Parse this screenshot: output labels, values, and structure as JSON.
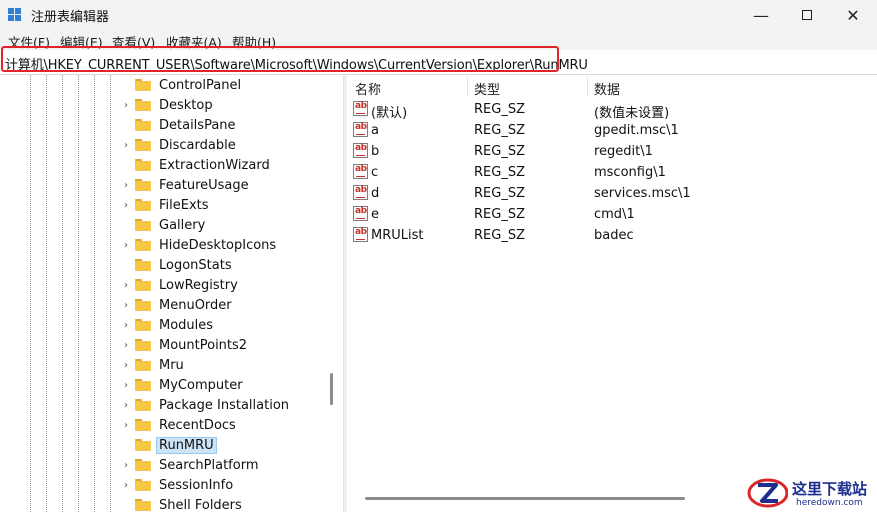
{
  "window": {
    "title": "注册表编辑器",
    "minimize": "—",
    "close": "✕"
  },
  "menu": [
    "文件(F)",
    "编辑(E)",
    "查看(V)",
    "收藏夹(A)",
    "帮助(H)"
  ],
  "address": "计算机\\HKEY_CURRENT_USER\\Software\\Microsoft\\Windows\\CurrentVersion\\Explorer\\RunMRU",
  "tree": {
    "items": [
      {
        "label": "ControlPanel",
        "expander": ""
      },
      {
        "label": "Desktop",
        "expander": "›"
      },
      {
        "label": "DetailsPane",
        "expander": ""
      },
      {
        "label": "Discardable",
        "expander": "›"
      },
      {
        "label": "ExtractionWizard",
        "expander": ""
      },
      {
        "label": "FeatureUsage",
        "expander": "›"
      },
      {
        "label": "FileExts",
        "expander": "›"
      },
      {
        "label": "Gallery",
        "expander": ""
      },
      {
        "label": "HideDesktopIcons",
        "expander": "›"
      },
      {
        "label": "LogonStats",
        "expander": ""
      },
      {
        "label": "LowRegistry",
        "expander": "›"
      },
      {
        "label": "MenuOrder",
        "expander": "›"
      },
      {
        "label": "Modules",
        "expander": "›"
      },
      {
        "label": "MountPoints2",
        "expander": "›"
      },
      {
        "label": "Mru",
        "expander": "›"
      },
      {
        "label": "MyComputer",
        "expander": "›"
      },
      {
        "label": "Package Installation",
        "expander": "›"
      },
      {
        "label": "RecentDocs",
        "expander": "›"
      },
      {
        "label": "RunMRU",
        "expander": "",
        "selected": true
      },
      {
        "label": "SearchPlatform",
        "expander": "›"
      },
      {
        "label": "SessionInfo",
        "expander": "›"
      },
      {
        "label": "Shell Folders",
        "expander": ""
      }
    ]
  },
  "values": {
    "columns": [
      "名称",
      "类型",
      "数据"
    ],
    "rows": [
      {
        "name": "(默认)",
        "type": "REG_SZ",
        "data": "(数值未设置)"
      },
      {
        "name": "a",
        "type": "REG_SZ",
        "data": "gpedit.msc\\1"
      },
      {
        "name": "b",
        "type": "REG_SZ",
        "data": "regedit\\1"
      },
      {
        "name": "c",
        "type": "REG_SZ",
        "data": "msconfig\\1"
      },
      {
        "name": "d",
        "type": "REG_SZ",
        "data": "services.msc\\1"
      },
      {
        "name": "e",
        "type": "REG_SZ",
        "data": "cmd\\1"
      },
      {
        "name": "MRUList",
        "type": "REG_SZ",
        "data": "badec"
      }
    ],
    "icon_text": "ab"
  },
  "watermark": {
    "text": "这里下载站",
    "url": "heredown.com"
  }
}
